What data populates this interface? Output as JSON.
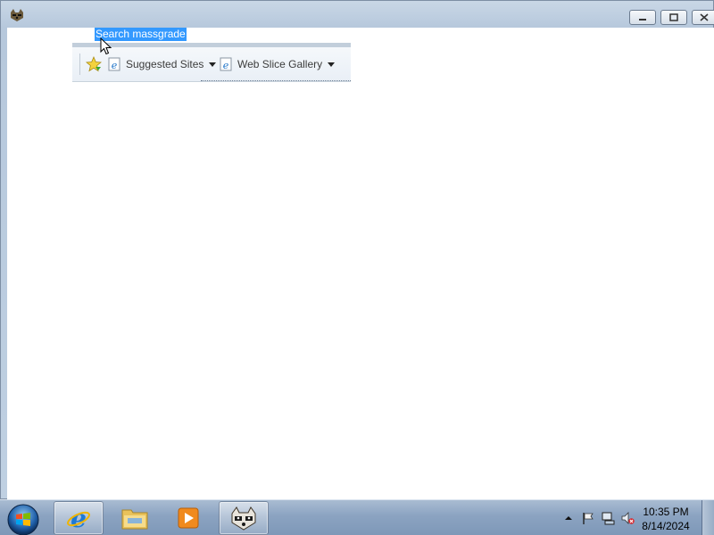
{
  "search_selection": "Search massgrade",
  "favorites_bar": {
    "items": [
      {
        "label": "Suggested Sites"
      },
      {
        "label": "Web Slice Gallery"
      }
    ]
  },
  "clock": {
    "time": "10:35 PM",
    "date": "8/14/2024"
  },
  "colors": {
    "selection": "#3399ff",
    "taskbar": "#8ba3c1"
  }
}
